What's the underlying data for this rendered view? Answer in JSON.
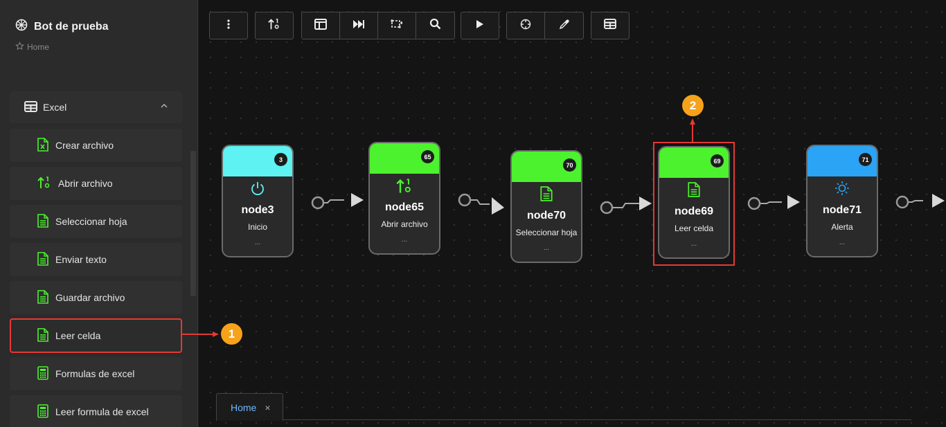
{
  "app": {
    "title": "Bot de prueba",
    "breadcrumb": "Home"
  },
  "sidebar": {
    "group": {
      "label": "Excel",
      "icon": "table-icon",
      "expanded": true
    },
    "items": [
      {
        "label": "Crear archivo",
        "icon": "excel-file-icon"
      },
      {
        "label": "Abrir archivo",
        "icon": "sort-arrows-icon"
      },
      {
        "label": "Seleccionar hoja",
        "icon": "document-icon"
      },
      {
        "label": "Enviar texto",
        "icon": "document-icon"
      },
      {
        "label": "Guardar archivo",
        "icon": "document-icon"
      },
      {
        "label": "Leer celda",
        "icon": "document-icon",
        "highlighted": true
      },
      {
        "label": "Formulas de excel",
        "icon": "calculator-icon"
      },
      {
        "label": "Leer formula de excel",
        "icon": "calculator-icon"
      }
    ]
  },
  "toolbar": {
    "buttons": [
      "more-vertical-icon",
      "sort-arrows-icon",
      "layout-icon",
      "skip-forward-icon",
      "transform-icon",
      "search-icon",
      "play-icon",
      "target-icon",
      "eyedropper-icon",
      "table-icon"
    ]
  },
  "nodes": [
    {
      "id": "node3",
      "badge": "3",
      "subtitle": "Inicio",
      "dots": "...",
      "color": "#5ef2f2",
      "icon": "power-icon"
    },
    {
      "id": "node65",
      "badge": "65",
      "subtitle": "Abrir archivo",
      "dots": "...",
      "color": "#4cf22e",
      "icon": "sort-arrows-icon"
    },
    {
      "id": "node70",
      "badge": "70",
      "subtitle": "Seleccionar hoja",
      "dots": "...",
      "color": "#4cf22e",
      "icon": "document-icon"
    },
    {
      "id": "node69",
      "badge": "69",
      "subtitle": "Leer celda",
      "dots": "...",
      "color": "#4cf22e",
      "icon": "document-icon",
      "highlighted": true
    },
    {
      "id": "node71",
      "badge": "71",
      "subtitle": "Alerta",
      "dots": "...",
      "color": "#2ba4f5",
      "icon": "sun-icon"
    }
  ],
  "callouts": [
    "1",
    "2"
  ],
  "tabs": [
    {
      "label": "Home",
      "close": "×"
    }
  ],
  "colors": {
    "accent_green": "#4cf22e",
    "highlight_red": "#e53935",
    "callout_orange": "#f7a21b",
    "tab_blue": "#6fb7ff"
  }
}
